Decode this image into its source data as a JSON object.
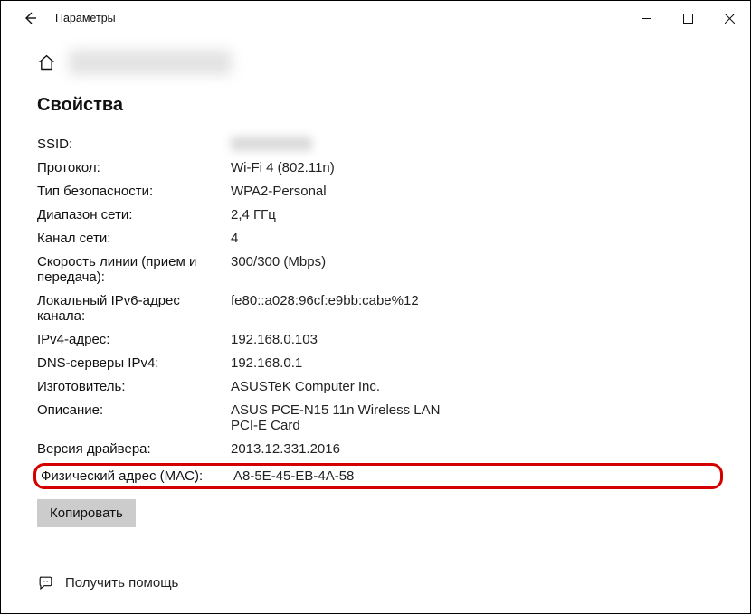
{
  "titlebar": {
    "title": "Параметры"
  },
  "section": {
    "title": "Свойства"
  },
  "props": {
    "ssid_label": "SSID:",
    "protocol_label": "Протокол:",
    "protocol_value": "Wi-Fi 4 (802.11n)",
    "security_label": "Тип безопасности:",
    "security_value": "WPA2-Personal",
    "band_label": "Диапазон сети:",
    "band_value": "2,4 ГГц",
    "channel_label": "Канал сети:",
    "channel_value": "4",
    "speed_label": "Скорость линии (прием и передача):",
    "speed_value": "300/300 (Mbps)",
    "ipv6ll_label": "Локальный IPv6-адрес канала:",
    "ipv6ll_value": "fe80::a028:96cf:e9bb:cabe%12",
    "ipv4_label": "IPv4-адрес:",
    "ipv4_value": "192.168.0.103",
    "dns_label": "DNS-серверы IPv4:",
    "dns_value": "192.168.0.1",
    "mfr_label": "Изготовитель:",
    "mfr_value": "ASUSTeK Computer Inc.",
    "desc_label": "Описание:",
    "desc_value": "ASUS PCE-N15 11n Wireless LAN PCI-E Card",
    "drv_label": "Версия драйвера:",
    "drv_value": "2013.12.331.2016",
    "mac_label": "Физический адрес (MAC):",
    "mac_value": "A8-5E-45-EB-4A-58"
  },
  "buttons": {
    "copy": "Копировать"
  },
  "footer": {
    "help": "Получить помощь"
  }
}
